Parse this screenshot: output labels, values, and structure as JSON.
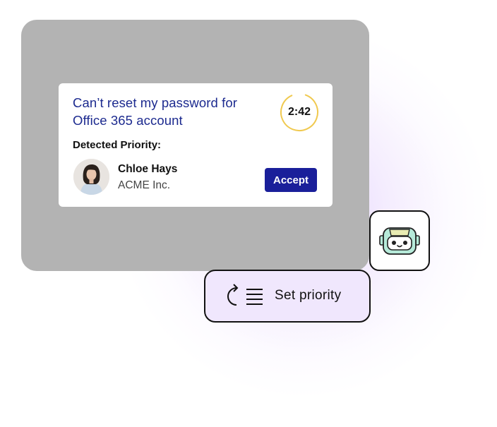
{
  "ticket": {
    "title": "Can’t reset my password for Office 365 account",
    "timer": "2:42",
    "priority_label": "Detected Priority:",
    "contact": {
      "name": "Chloe Hays",
      "company": "ACME Inc."
    },
    "accept_label": "Accept"
  },
  "action": {
    "icon": "refresh-list-icon",
    "label": "Set priority"
  },
  "bot": {
    "icon": "robot-icon"
  },
  "colors": {
    "accent": "#1a1f9a",
    "title": "#1c2a8f",
    "timer_ring": "#f0c94f",
    "panel": "#b3b3b3",
    "action_bg": "#f0e7fd"
  }
}
